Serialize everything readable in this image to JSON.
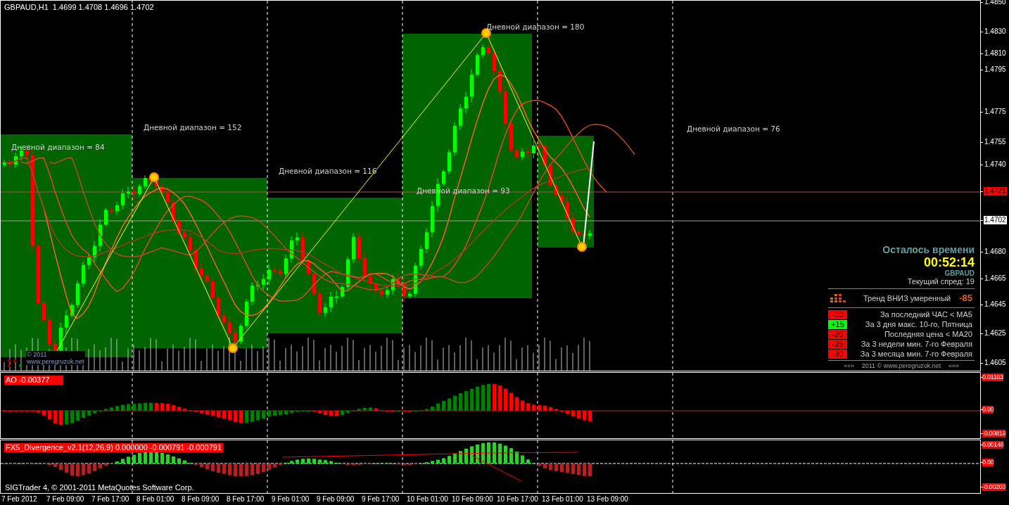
{
  "chart": {
    "header": "GBPAUD,H1  1.4699 1.4708 1.4696 1.4702",
    "range_labels": [
      "Дневной диапазон = 84",
      "Дневной диапазон = 152",
      "Дневной диапазон = 116",
      "Дневной диапазон = 93",
      "Дневной диапазон = 180",
      "Дневной диапазон = 76"
    ],
    "corner_note": [
      "© 2011",
      "www.peregruzok.net"
    ],
    "price_axis": [
      {
        "label": "1.4850",
        "kind": "tick"
      },
      {
        "label": "1.4830",
        "kind": "tick"
      },
      {
        "label": "1.4810",
        "kind": "tick"
      },
      {
        "label": "1.4795",
        "kind": "tick"
      },
      {
        "label": "1.4775",
        "kind": "tick"
      },
      {
        "label": "1.4755",
        "kind": "tick"
      },
      {
        "label": "1.4740",
        "kind": "tick"
      },
      {
        "label": "1.4721",
        "kind": "ask"
      },
      {
        "label": "1.4702",
        "kind": "bid"
      },
      {
        "label": "1.4680",
        "kind": "tick"
      },
      {
        "label": "1.4665",
        "kind": "tick"
      },
      {
        "label": "1.4645",
        "kind": "tick"
      },
      {
        "label": "1.4625",
        "kind": "tick"
      },
      {
        "label": "1.4605",
        "kind": "tick"
      }
    ]
  },
  "info_panel": {
    "title": "Осталось времени",
    "timer": "00:52:14",
    "symbol": "GBPAUD",
    "spread": "Текущий спред: 19",
    "trend": "Тренд ВНИЗ умеренный",
    "trend_score": "-85",
    "factors": [
      {
        "score": "-10",
        "text": "За последний ЧАС < MA5",
        "color": "#ff0000"
      },
      {
        "score": "+15",
        "text": "За 3 дня макс. 10-го, Пятница",
        "color": "#00ff00"
      },
      {
        "score": "-20",
        "text": "Последняя цена < MA20",
        "color": "#ff0000"
      },
      {
        "score": "-25",
        "text": "За 3 недели мин. 7-го Февраля",
        "color": "#ff0000"
      },
      {
        "score": "-30",
        "text": "За 3 месяца мин. 7-го Февраля",
        "color": "#ff0000"
      }
    ],
    "footer": [
      "»»»",
      "2011 © www.peregruzok.net",
      "«««"
    ]
  },
  "ao": {
    "label": "AO -0.00377",
    "axis": [
      "0.01163",
      "0.00",
      "-0.00819"
    ]
  },
  "divergence": {
    "label": "FX5_Divergence_v2.1(12,26,9) 0.000000 -0.000791 -0.000791",
    "axis": [
      "0.00148",
      "0.00",
      "-0.00203"
    ],
    "copyright": "SIGTrader 4, © 2001-2011 MetaQuotes Software Corp."
  },
  "time_axis": [
    "7 Feb 2012",
    "7 Feb 09:00",
    "7 Feb 17:00",
    "8 Feb 01:00",
    "8 Feb 09:00",
    "8 Feb 17:00",
    "9 Feb 01:00",
    "9 Feb 09:00",
    "9 Feb 17:00",
    "10 Feb 01:00",
    "10 Feb 09:00",
    "10 Feb 17:00",
    "13 Feb 01:00",
    "13 Feb 09:00"
  ]
}
